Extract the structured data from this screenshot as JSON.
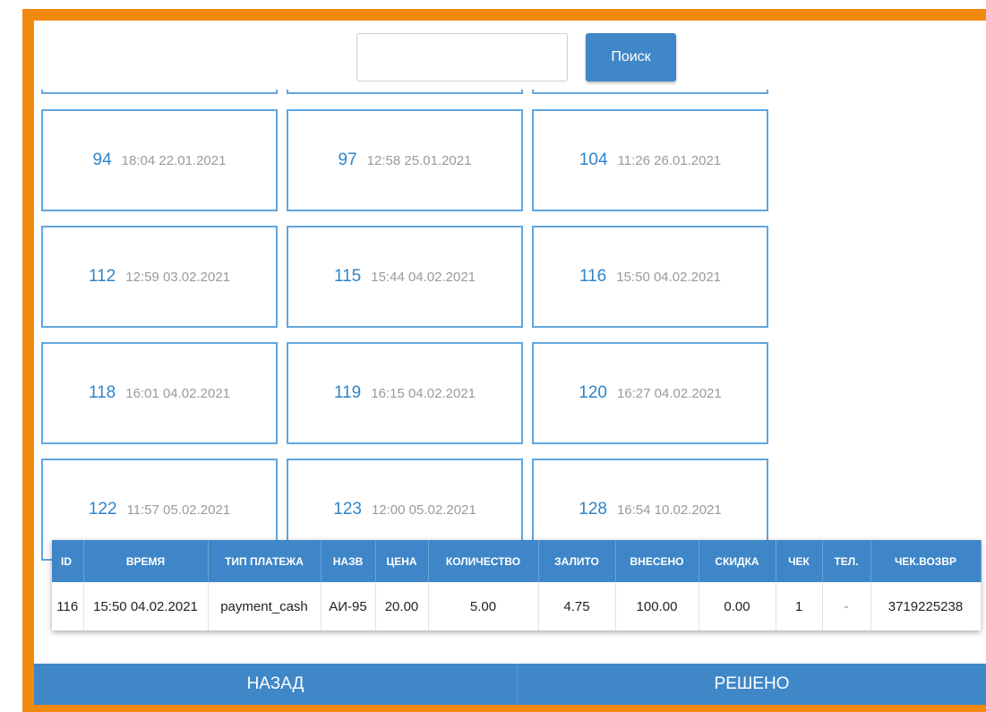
{
  "search": {
    "placeholder": "",
    "value": "",
    "button_label": "Поиск"
  },
  "cards": [
    {
      "id": "94",
      "time": "18:04 22.01.2021"
    },
    {
      "id": "97",
      "time": "12:58 25.01.2021"
    },
    {
      "id": "104",
      "time": "11:26 26.01.2021"
    },
    {
      "id": "112",
      "time": "12:59 03.02.2021"
    },
    {
      "id": "115",
      "time": "15:44 04.02.2021"
    },
    {
      "id": "116",
      "time": "15:50 04.02.2021"
    },
    {
      "id": "118",
      "time": "16:01 04.02.2021"
    },
    {
      "id": "119",
      "time": "16:15 04.02.2021"
    },
    {
      "id": "120",
      "time": "16:27 04.02.2021"
    },
    {
      "id": "122",
      "time": "11:57 05.02.2021"
    },
    {
      "id": "123",
      "time": "12:00 05.02.2021"
    },
    {
      "id": "128",
      "time": "16:54 10.02.2021"
    }
  ],
  "table": {
    "headers": [
      "ID",
      "ВРЕМЯ",
      "ТИП ПЛАТЕЖА",
      "НАЗВ",
      "ЦЕНА",
      "КОЛИЧЕСТВО",
      "ЗАЛИТО",
      "ВНЕСЕНО",
      "СКИДКА",
      "ЧЕК",
      "ТЕЛ.",
      "ЧЕК.ВОЗВР"
    ],
    "row": [
      "116",
      "15:50 04.02.2021",
      "payment_cash",
      "АИ-95",
      "20.00",
      "5.00",
      "4.75",
      "100.00",
      "0.00",
      "1",
      "-",
      "3719225238"
    ]
  },
  "bottom": {
    "back_label": "НАЗАД",
    "resolved_label": "РЕШЕНО"
  },
  "colors": {
    "accent": "#3f87c7",
    "frame": "#f28a10",
    "card_border": "#62a6dd"
  }
}
